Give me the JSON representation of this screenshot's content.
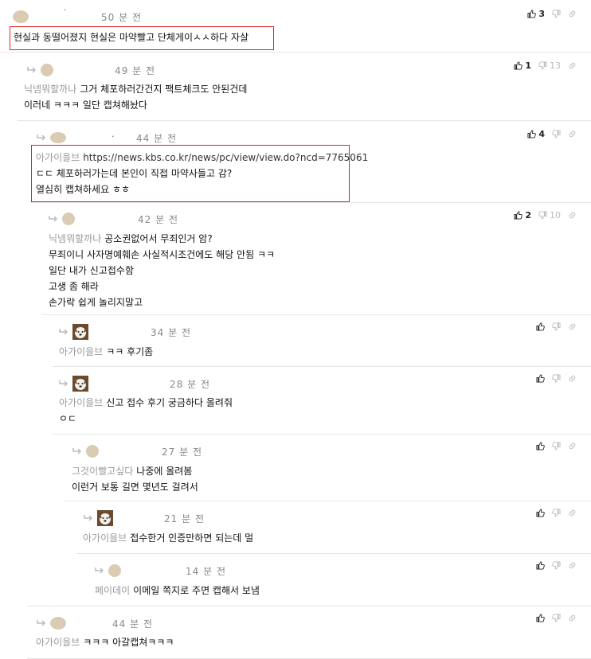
{
  "comments": [
    {
      "time": "50 분 전",
      "dot": "·",
      "likes": "3",
      "body": [
        [
          "",
          "현실과 동떨어졌지 현실은 마약빨고 단체게이ㅅㅅ하다 자살"
        ]
      ]
    },
    {
      "time": "49 분 전",
      "likes": "1",
      "dislikes": "13",
      "body": [
        [
          "닉넴뭐할까나",
          "그거 체포하러간건지 팩트체크도 안된건데"
        ],
        [
          "",
          "이러네 ㅋㅋㅋ 일단 캡쳐해놨다"
        ]
      ]
    },
    {
      "time": "44 분 전",
      "dot": ".",
      "likes": "4",
      "body": [
        [
          "아가이을브",
          "https://news.kbs.co.kr/news/pc/view/view.do?ncd=7765061"
        ],
        [
          "",
          "ㄷㄷ 체포하러가는데 본인이 직접 마약사들고 감?"
        ],
        [
          "",
          "열심히 캡쳐하세요 ㅎㅎ"
        ]
      ]
    },
    {
      "time": "42 분 전",
      "likes": "2",
      "dislikes": "10",
      "body": [
        [
          "닉넴뭐할까나",
          "공소권없어서 무죄인거 암?"
        ],
        [
          "",
          "무죄이니 사자명예훼손 사실적시조건에도 해당 안됨 ㅋㅋ"
        ],
        [
          "",
          "일단 내가 신고접수함"
        ],
        [
          "",
          "고생 좀 해라"
        ],
        [
          "",
          "손가락 쉽게 놀리지말고"
        ]
      ]
    },
    {
      "time": "34 분 전",
      "body": [
        [
          "아가이을브",
          "ㅋㅋ 후기좀"
        ]
      ]
    },
    {
      "time": "28 분 전",
      "body": [
        [
          "아가이을브",
          "신고 접수 후기 궁금하다 올려줘"
        ],
        [
          "",
          "ㅇㄷ"
        ]
      ]
    },
    {
      "time": "27 분 전",
      "body": [
        [
          "그것이빨고싶다",
          "나중에 올려봄"
        ],
        [
          "",
          "이런거 보통 길면 몇년도 걸려서"
        ]
      ]
    },
    {
      "time": "21 분 전",
      "body": [
        [
          "아가이을브",
          "접수한거 인증만하면 되는데 멀"
        ]
      ]
    },
    {
      "time": "14 분 전",
      "body": [
        [
          "페이데이",
          "이메일 쪽지로 주면 캡해서 보냄"
        ]
      ]
    },
    {
      "time": "44 분 전",
      "body": [
        [
          "아가이을브",
          "ㅋㅋㅋ 아갈캡쳐ㅋㅋㅋ"
        ]
      ]
    }
  ],
  "icons": {
    "like": "thumbs-up-icon",
    "dislike": "thumbs-down-icon",
    "link": "link-icon",
    "reply": "reply-arrow-icon"
  }
}
